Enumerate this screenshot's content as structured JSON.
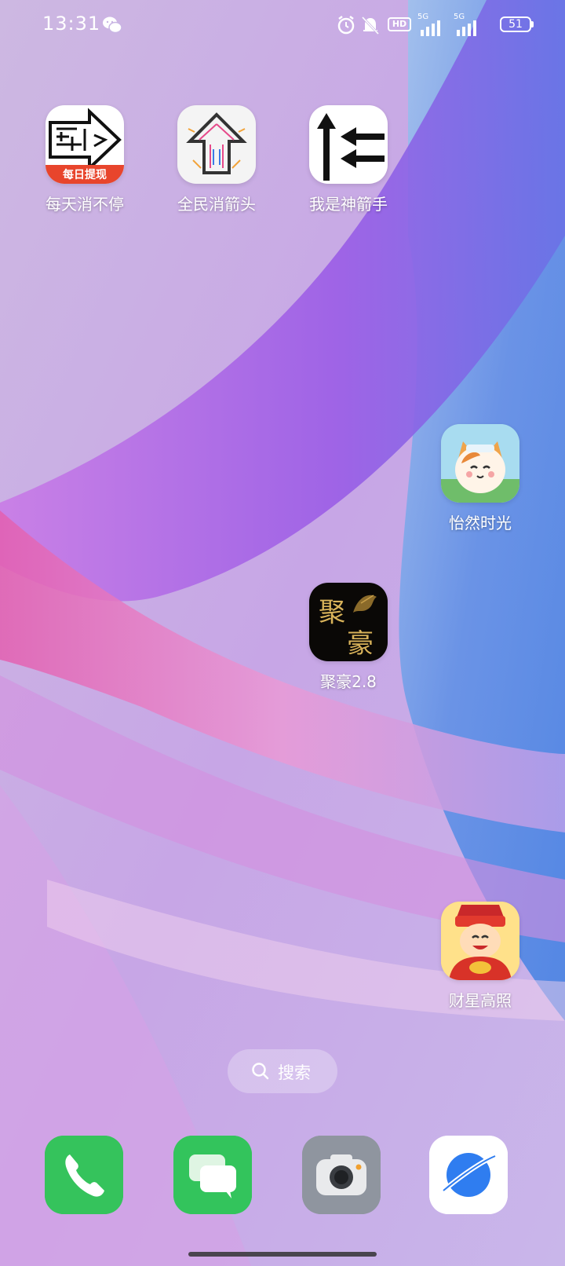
{
  "status_bar": {
    "time": "13:31",
    "icons": [
      "wechat-icon",
      "alarm-icon",
      "mute-bell-icon",
      "hd-icon",
      "5g-signal-icon",
      "5g-signal-icon"
    ],
    "battery": "51",
    "signal_label_1": "5G",
    "signal_label_2": "5G",
    "hd_label": "HD"
  },
  "apps": [
    {
      "id": "meitian",
      "label": "每天消不停",
      "badge": "每日提现"
    },
    {
      "id": "quanmin",
      "label": "全民消箭头"
    },
    {
      "id": "woshi",
      "label": "我是神箭手"
    },
    {
      "id": "yiran",
      "label": "怡然时光"
    },
    {
      "id": "juhao",
      "label": "聚豪2.8",
      "glyph1": "聚",
      "glyph2": "豪"
    },
    {
      "id": "caixing",
      "label": "财星高照"
    }
  ],
  "search": {
    "label": "搜索"
  },
  "dock": [
    "phone-icon",
    "messages-icon",
    "camera-icon",
    "browser-icon"
  ],
  "colors": {
    "accent_green": "#34c759",
    "badge_red": "#e8452c"
  }
}
